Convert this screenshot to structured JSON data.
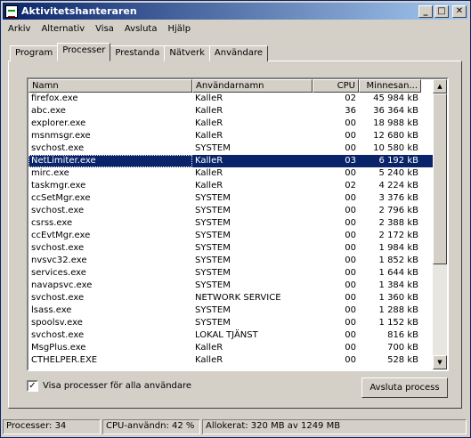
{
  "window": {
    "title": "Aktivitetshanteraren",
    "btn_min": "_",
    "btn_max": "□",
    "btn_close": "✕"
  },
  "menu": [
    "Arkiv",
    "Alternativ",
    "Visa",
    "Avsluta",
    "Hjälp"
  ],
  "tabs": [
    {
      "label": "Program",
      "active": false
    },
    {
      "label": "Processer",
      "active": true
    },
    {
      "label": "Prestanda",
      "active": false
    },
    {
      "label": "Nätverk",
      "active": false
    },
    {
      "label": "Användare",
      "active": false
    }
  ],
  "columns": {
    "name": "Namn",
    "user": "Användarnamn",
    "cpu": "CPU",
    "mem": "Minnesan..."
  },
  "processes": [
    {
      "name": "firefox.exe",
      "user": "KalleR",
      "cpu": "02",
      "mem": "45 984 kB"
    },
    {
      "name": "abc.exe",
      "user": "KalleR",
      "cpu": "36",
      "mem": "36 364 kB"
    },
    {
      "name": "explorer.exe",
      "user": "KalleR",
      "cpu": "00",
      "mem": "18 988 kB"
    },
    {
      "name": "msnmsgr.exe",
      "user": "KalleR",
      "cpu": "00",
      "mem": "12 680 kB"
    },
    {
      "name": "svchost.exe",
      "user": "SYSTEM",
      "cpu": "00",
      "mem": "10 580 kB"
    },
    {
      "name": "NetLimiter.exe",
      "user": "KalleR",
      "cpu": "03",
      "mem": "6 192 kB",
      "selected": true
    },
    {
      "name": "mirc.exe",
      "user": "KalleR",
      "cpu": "00",
      "mem": "5 240 kB"
    },
    {
      "name": "taskmgr.exe",
      "user": "KalleR",
      "cpu": "02",
      "mem": "4 224 kB"
    },
    {
      "name": "ccSetMgr.exe",
      "user": "SYSTEM",
      "cpu": "00",
      "mem": "3 376 kB"
    },
    {
      "name": "svchost.exe",
      "user": "SYSTEM",
      "cpu": "00",
      "mem": "2 796 kB"
    },
    {
      "name": "csrss.exe",
      "user": "SYSTEM",
      "cpu": "00",
      "mem": "2 388 kB"
    },
    {
      "name": "ccEvtMgr.exe",
      "user": "SYSTEM",
      "cpu": "00",
      "mem": "2 172 kB"
    },
    {
      "name": "svchost.exe",
      "user": "SYSTEM",
      "cpu": "00",
      "mem": "1 984 kB"
    },
    {
      "name": "nvsvc32.exe",
      "user": "SYSTEM",
      "cpu": "00",
      "mem": "1 852 kB"
    },
    {
      "name": "services.exe",
      "user": "SYSTEM",
      "cpu": "00",
      "mem": "1 644 kB"
    },
    {
      "name": "navapsvc.exe",
      "user": "SYSTEM",
      "cpu": "00",
      "mem": "1 384 kB"
    },
    {
      "name": "svchost.exe",
      "user": "NETWORK SERVICE",
      "cpu": "00",
      "mem": "1 360 kB"
    },
    {
      "name": "lsass.exe",
      "user": "SYSTEM",
      "cpu": "00",
      "mem": "1 288 kB"
    },
    {
      "name": "spoolsv.exe",
      "user": "SYSTEM",
      "cpu": "00",
      "mem": "1 152 kB"
    },
    {
      "name": "svchost.exe",
      "user": "LOKAL TJÄNST",
      "cpu": "00",
      "mem": "816 kB"
    },
    {
      "name": "MsgPlus.exe",
      "user": "KalleR",
      "cpu": "00",
      "mem": "700 kB"
    },
    {
      "name": "CTHELPER.EXE",
      "user": "KalleR",
      "cpu": "00",
      "mem": "528 kB"
    }
  ],
  "show_all_users": {
    "label": "Visa processer för alla användare",
    "checked": true
  },
  "end_process_button": "Avsluta process",
  "status": {
    "processes": "Processer: 34",
    "cpu": "CPU-användn: 42 %",
    "allocated": "Allokerat: 320 MB av 1249 MB"
  }
}
